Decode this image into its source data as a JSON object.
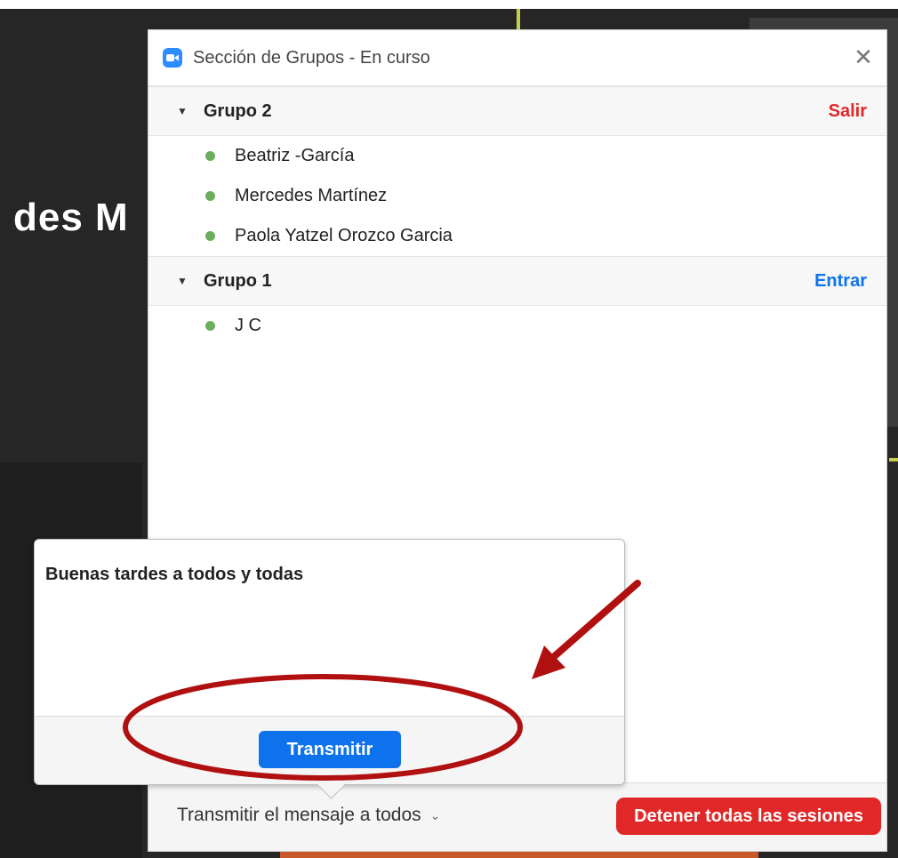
{
  "background": {
    "partial_text": "des M"
  },
  "window": {
    "title": "Sección de Grupos - En curso",
    "close_icon": "close-icon"
  },
  "groups": [
    {
      "name": "Grupo 2",
      "action": "Salir",
      "action_color": "#e02828",
      "members": [
        "Beatriz -García",
        "Mercedes Martínez",
        "Paola Yatzel Orozco Garcia"
      ]
    },
    {
      "name": "Grupo 1",
      "action": "Entrar",
      "action_color": "#0e72ed",
      "members": [
        "J C"
      ]
    }
  ],
  "popup": {
    "message": "Buenas tardes a todos y todas",
    "send_label": "Transmitir"
  },
  "footer": {
    "broadcast_label": "Transmitir el mensaje a todos",
    "stop_label": "Detener todas las sesiones"
  },
  "colors": {
    "accent_blue": "#0e72ed",
    "danger_red": "#e02828",
    "status_green": "#6aae5e",
    "annotation_red": "#b01010"
  }
}
